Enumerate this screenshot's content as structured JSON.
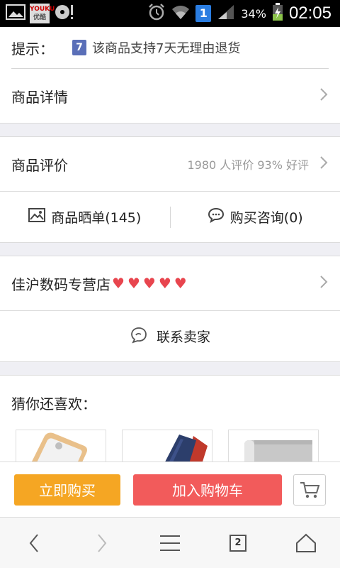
{
  "status_bar": {
    "youku_logo_top": "YOUKU",
    "youku_logo_bottom": "优酷",
    "notification_badge": "1",
    "battery_percent": "34%",
    "clock": "02:05"
  },
  "tip": {
    "label": "提示：",
    "badge": "7",
    "text": "该商品支持7天无理由退货"
  },
  "detail": {
    "title": "商品详情"
  },
  "reviews": {
    "title": "商品评价",
    "summary": "1980 人评价 93% 好评"
  },
  "review_tabs": {
    "photos": "商品晒单(145)",
    "consult": "购买咨询(0)"
  },
  "store": {
    "name": "佳沪数码专营店",
    "rating_hearts": 5
  },
  "contact": {
    "label": "联系卖家"
  },
  "recommend": {
    "title": "猜你还喜欢："
  },
  "actions": {
    "buy_now": "立即购买",
    "add_to_cart": "加入购物车"
  },
  "browser_nav": {
    "tab_count": "2"
  },
  "colors": {
    "buy_now": "#f5a623",
    "add_to_cart": "#f25b5b",
    "heart": "#e8454e"
  }
}
